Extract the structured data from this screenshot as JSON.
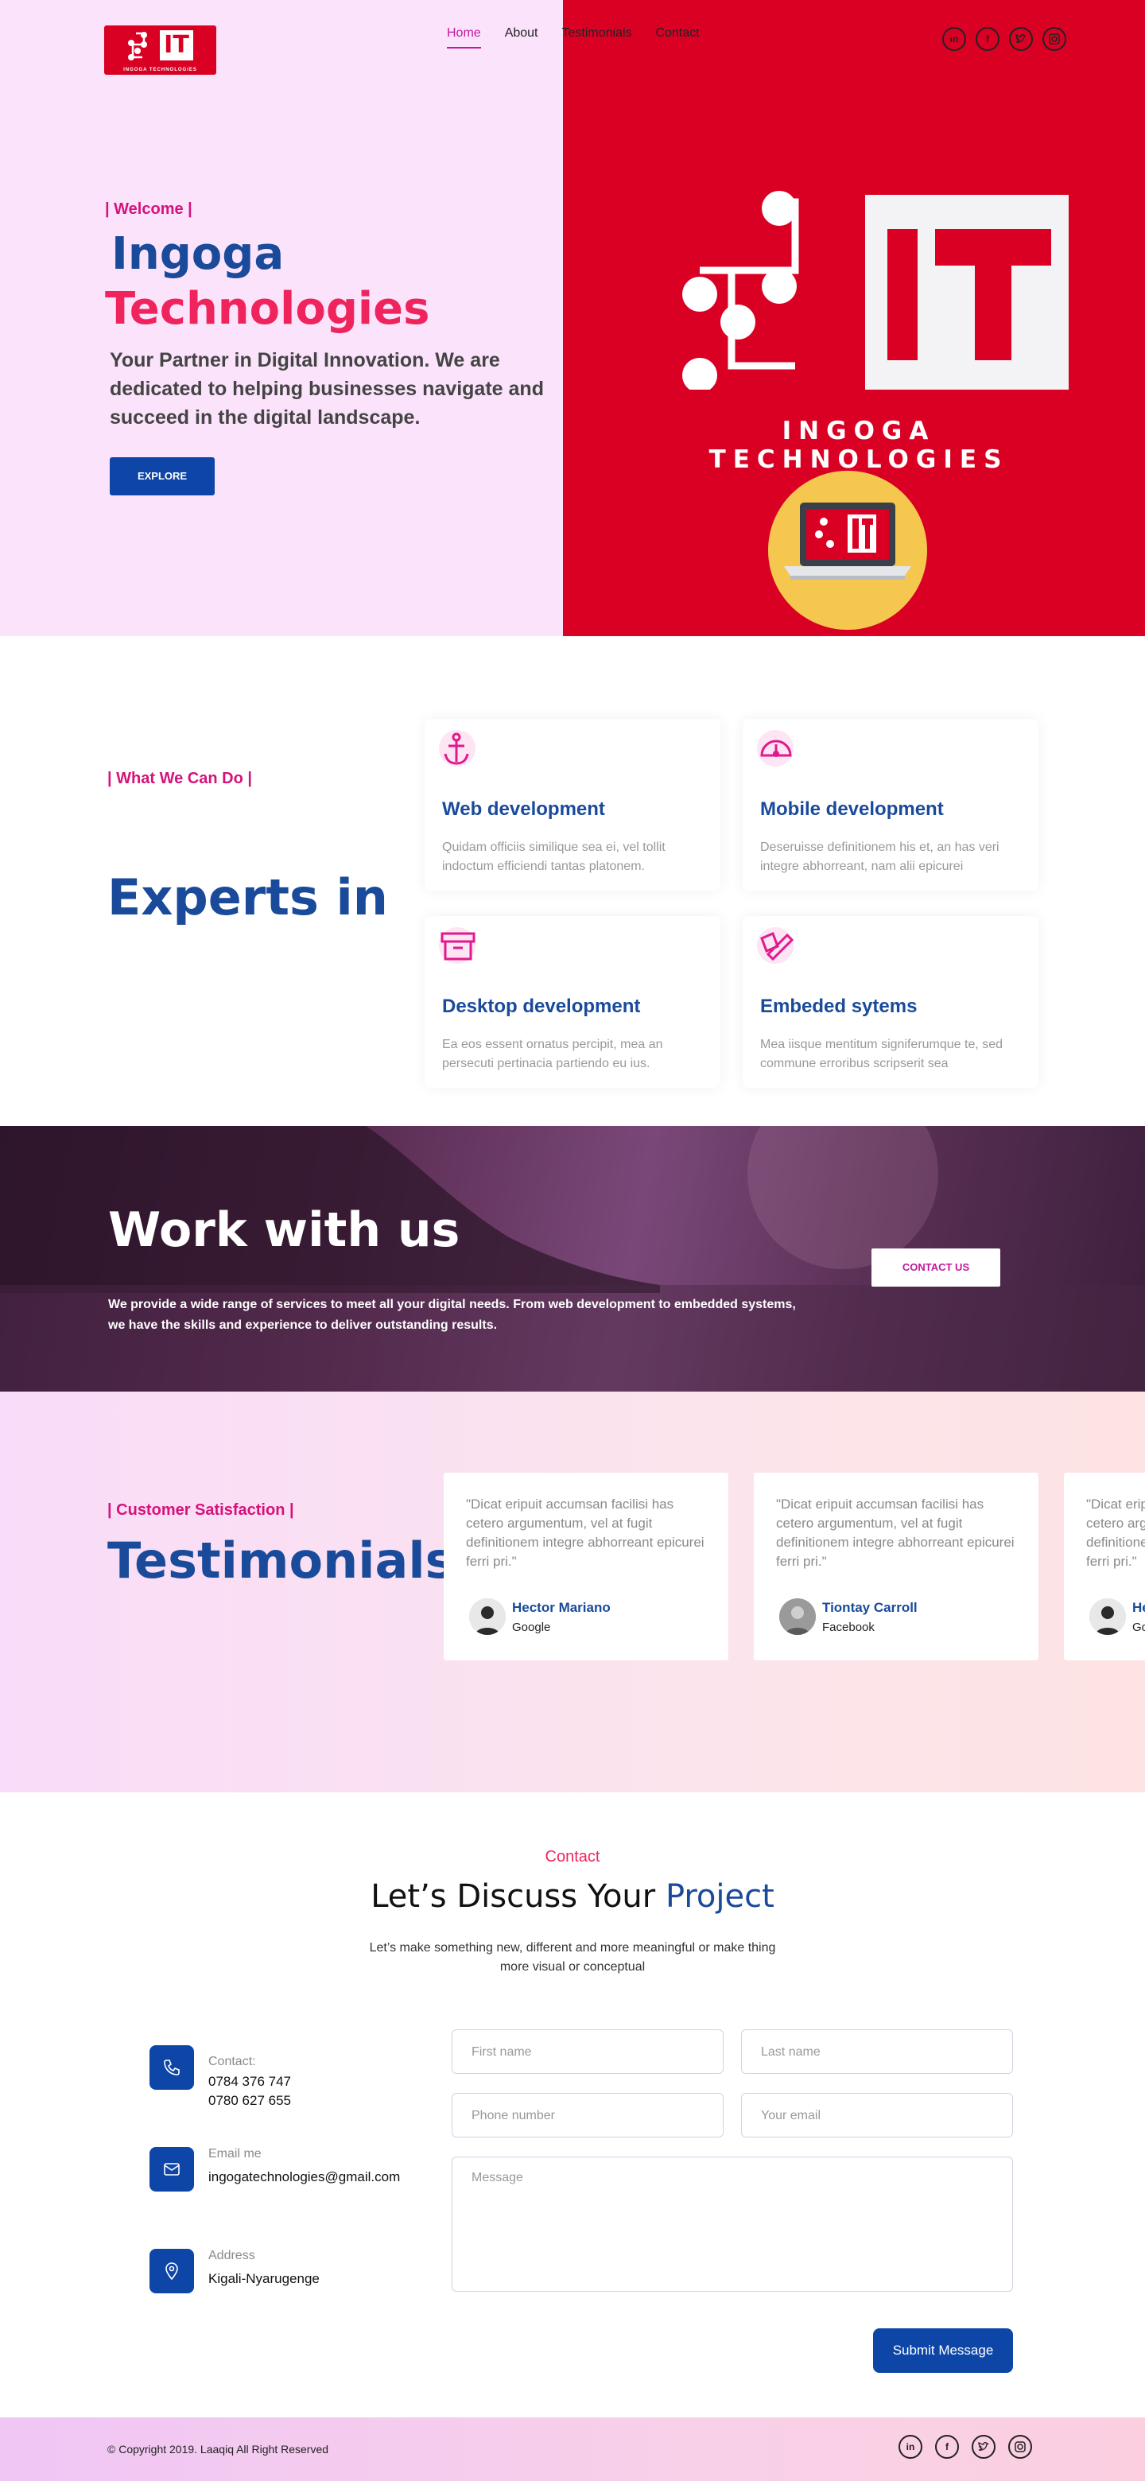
{
  "brand": {
    "logo_text": "IT",
    "logo_sub": "INGOGA TECHNOLOGIES",
    "big_brand": "INGOGA TECHNOLOGIES",
    "red": "#d90024",
    "blue": "#1a4a9a",
    "pink": "#d6127a"
  },
  "nav": {
    "items": [
      "Home",
      "About",
      "Testimonials",
      "Contact"
    ],
    "active": "Home"
  },
  "social": [
    "linkedin-icon",
    "facebook-icon",
    "twitter-icon",
    "instagram-icon"
  ],
  "hero": {
    "welcome": "| Welcome |",
    "title_line1": "Ingoga",
    "title_line2": "Technologies",
    "desc": "Your Partner in Digital Innovation. We are dedicated to helping businesses navigate and succeed in the digital landscape.",
    "button": "EXPLORE"
  },
  "services": {
    "tag": "| What We Can Do |",
    "title": "Experts in",
    "cards": [
      {
        "title": "Web development",
        "text": "Quidam officiis similique sea ei, vel tollit indoctum efficiendi tantas platonem.",
        "icon": "anchor-icon"
      },
      {
        "title": "Mobile development",
        "text": "Deseruisse definitionem his et, an has veri integre abhorreant, nam alii epicurei",
        "icon": "gauge-icon"
      },
      {
        "title": "Desktop development",
        "text": "Ea eos essent ornatus percipit, mea an persecuti pertinacia partiendo eu ius.",
        "icon": "archive-icon"
      },
      {
        "title": "Embeded sytems",
        "text": "Mea iisque mentitum signiferumque te, sed commune erroribus scripserit sea",
        "icon": "pen-icon"
      }
    ]
  },
  "work": {
    "title": "Work with us",
    "desc": "We provide a wide range of services to meet all your digital needs. From web development to embedded systems, we have the skills and experience to deliver outstanding results.",
    "button": "CONTACT US"
  },
  "testimonials": {
    "tag": "| Customer Satisfaction |",
    "title": "Testimonials",
    "items": [
      {
        "quote": "\"Dicat eripuit accumsan facilisi has cetero argumentum, vel at fugit definitionem integre abhorreant epicurei ferri pri.\"",
        "name": "Hector Mariano",
        "company": "Google"
      },
      {
        "quote": "\"Dicat eripuit accumsan facilisi has cetero argumentum, vel at fugit definitionem integre abhorreant epicurei ferri pri.\"",
        "name": "Tiontay Carroll",
        "company": "Facebook"
      },
      {
        "quote": "\"Dicat eripuit accumsan facilisi has cetero argumentum, vel at fugit definitionem integre abhorreant epicurei ferri pri.\"",
        "name": "He",
        "company": "Go"
      }
    ]
  },
  "contact": {
    "tag": "Contact",
    "title_a": "Let’s Discuss Your",
    "title_b": "Project",
    "desc": "Let’s make something new, different and more meaningful or make thing more visual or conceptual",
    "phone_label": "Contact:",
    "phone1": "0784 376 747",
    "phone2": "0780 627 655",
    "email_label": "Email me",
    "email": "ingogatechnologies@gmail.com",
    "address_label": "Address",
    "address": "Kigali-Nyarugenge",
    "form": {
      "first": "First name",
      "last": "Last name",
      "phone": "Phone number",
      "email": "Your email",
      "message": "Message",
      "submit": "Submit Message"
    }
  },
  "footer": {
    "copyright": "© Copyright 2019. Laaqiq All Right Reserved"
  }
}
